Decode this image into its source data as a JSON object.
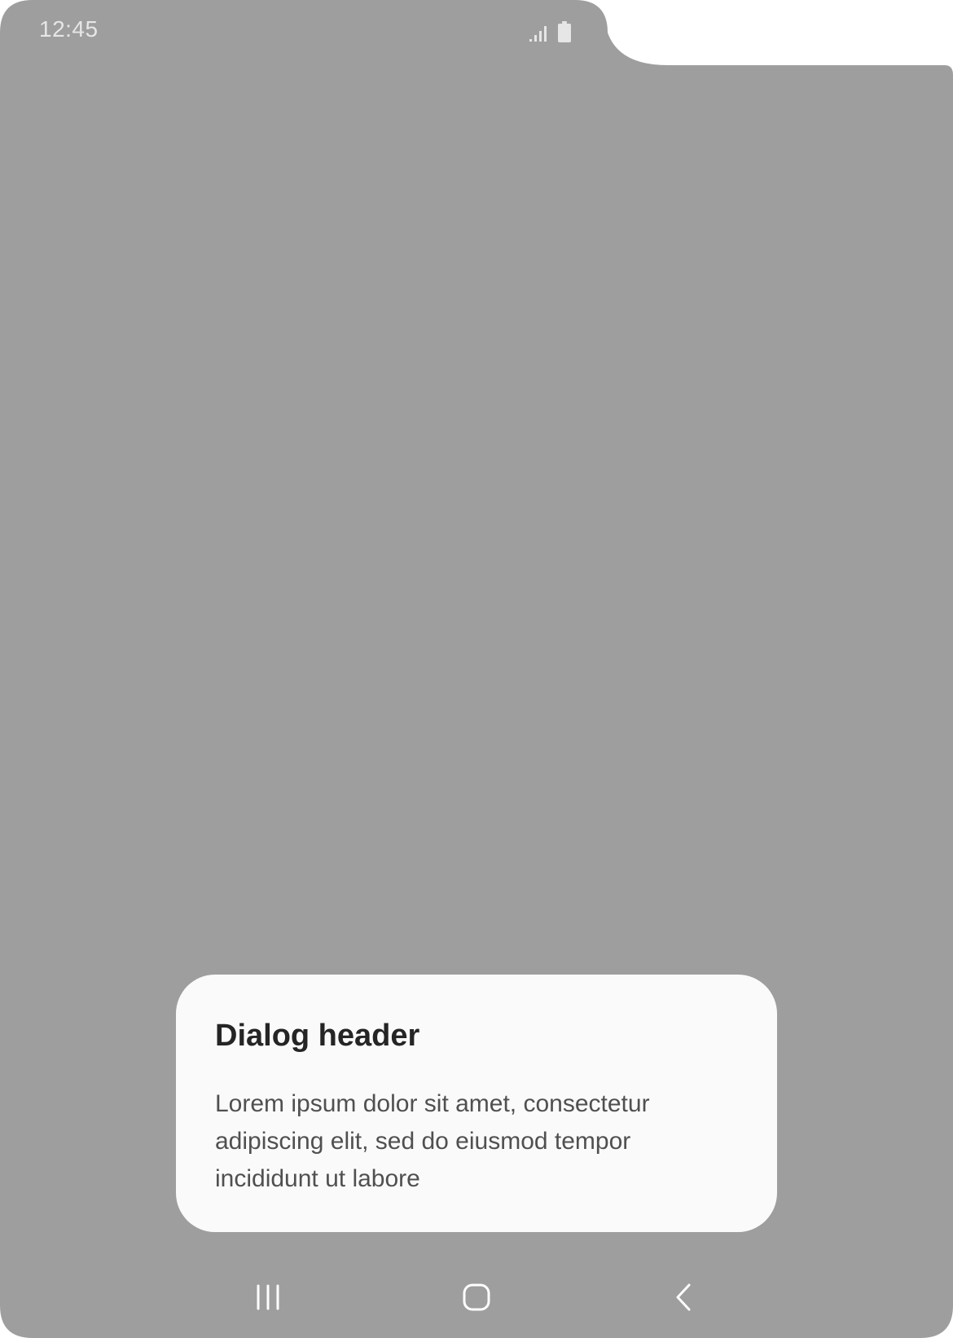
{
  "status_bar": {
    "time": "12:45",
    "signal_icon": "signal-icon",
    "battery_icon": "battery-icon"
  },
  "dialog": {
    "header": "Dialog header",
    "body": "Lorem ipsum dolor sit amet, consectetur adipiscing elit, sed do eiusmod tempor incididunt ut labore"
  },
  "nav_bar": {
    "recents_icon": "recents-icon",
    "home_icon": "home-icon",
    "back_icon": "back-icon"
  },
  "colors": {
    "scrim": "#9e9e9e",
    "dialog_background": "#fafafa",
    "header_text": "#252525",
    "body_text": "#505050",
    "status_text": "#e6e6e6",
    "nav_icon": "#ffffff"
  }
}
